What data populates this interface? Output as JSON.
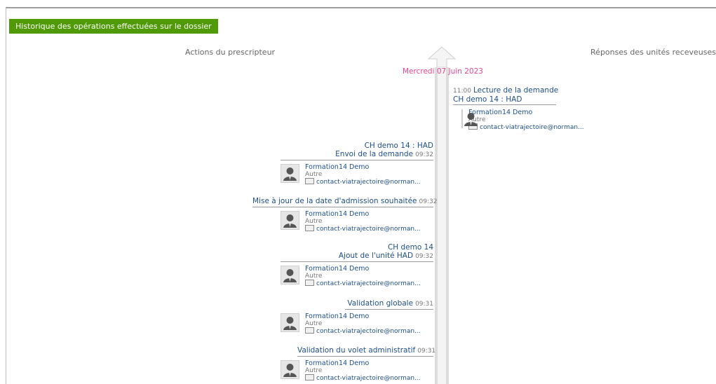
{
  "header": {
    "title": "Historique des opérations effectuées sur le dossier"
  },
  "columns": {
    "left": "Actions du prescripteur",
    "right": "Réponses des unités receveuses"
  },
  "date": "Mercredi 07 Juin 2023",
  "right_entries": [
    {
      "time": "11:00",
      "title": "Lecture de la demande",
      "subtitle": "CH demo 14 : HAD",
      "user": {
        "name": "Formation14 Demo",
        "role": "Autre",
        "email": "contact-viatrajectoire@norman..."
      }
    }
  ],
  "left_entries": [
    {
      "lines": [
        "CH demo 14 : HAD",
        "Envoi de la demande"
      ],
      "time": "09:32",
      "user": {
        "name": "Formation14 Demo",
        "role": "Autre",
        "email": "contact-viatrajectoire@norman..."
      }
    },
    {
      "lines": [
        "Mise à jour de la date d'admission souhaitée"
      ],
      "time": "09:32",
      "user": {
        "name": "Formation14 Demo",
        "role": "Autre",
        "email": "contact-viatrajectoire@norman..."
      }
    },
    {
      "lines": [
        "CH demo 14",
        "Ajout de l'unité HAD"
      ],
      "time": "09:32",
      "user": {
        "name": "Formation14 Demo",
        "role": "Autre",
        "email": "contact-viatrajectoire@norman..."
      }
    },
    {
      "lines": [
        "Validation globale"
      ],
      "time": "09:31",
      "user": {
        "name": "Formation14 Demo",
        "role": "Autre",
        "email": "contact-viatrajectoire@norman..."
      }
    },
    {
      "lines": [
        "Validation du volet administratif"
      ],
      "time": "09:31",
      "user": {
        "name": "Formation14 Demo",
        "role": "Autre",
        "email": "contact-viatrajectoire@norman..."
      }
    }
  ],
  "colors": {
    "header_bg": "#4f9a06",
    "date": "#e8468f",
    "link": "#1d4f8c"
  }
}
